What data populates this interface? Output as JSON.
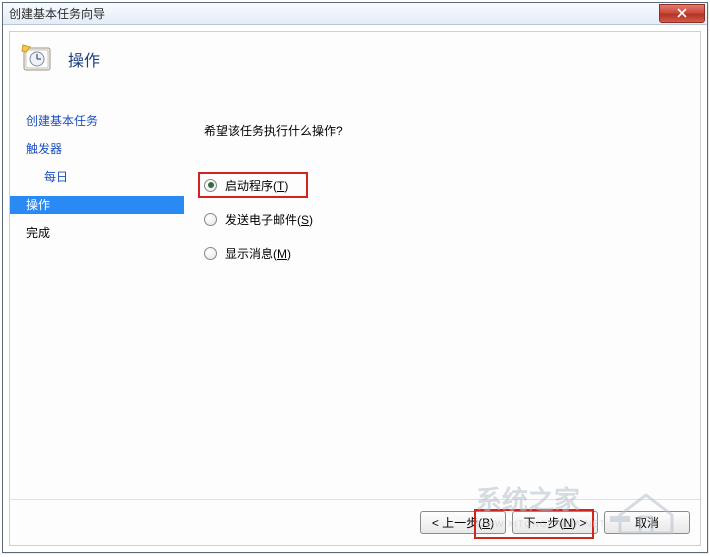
{
  "window": {
    "title": "创建基本任务向导"
  },
  "header": {
    "title": "操作"
  },
  "sidebar": {
    "items": [
      {
        "label": "创建基本任务"
      },
      {
        "label": "触发器"
      },
      {
        "label": "每日"
      },
      {
        "label": "操作"
      },
      {
        "label": "完成"
      }
    ],
    "active_index": 3
  },
  "main": {
    "prompt": "希望该任务执行什么操作?",
    "options": [
      {
        "label_prefix": "启动程序(",
        "mnemonic": "T",
        "label_suffix": ")",
        "checked": true
      },
      {
        "label_prefix": "发送电子邮件(",
        "mnemonic": "S",
        "label_suffix": ")",
        "checked": false
      },
      {
        "label_prefix": "显示消息(",
        "mnemonic": "M",
        "label_suffix": ")",
        "checked": false
      }
    ]
  },
  "footer": {
    "back_prefix": "< 上一步(",
    "back_mnemonic": "B",
    "back_suffix": ")",
    "next_prefix": "下一步(",
    "next_mnemonic": "N",
    "next_suffix": ") >",
    "cancel": "取消"
  },
  "watermark": {
    "text": "系统之家",
    "sub": "WWW.XITONGZHIJIA.NET"
  }
}
